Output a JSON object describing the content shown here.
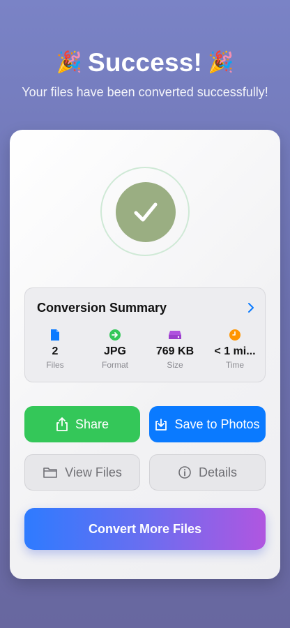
{
  "header": {
    "emoji_left": "🎉",
    "title": "Success!",
    "emoji_right": "🎉",
    "subtitle": "Your files have been converted successfully!"
  },
  "status_icon": "checkmark-circle-icon",
  "summary": {
    "title": "Conversion Summary",
    "chevron_icon": "chevron-right-icon",
    "stats": [
      {
        "icon": "document-icon",
        "icon_color": "#0a7aff",
        "value": "2",
        "label": "Files"
      },
      {
        "icon": "arrow-right-circle-icon",
        "icon_color": "#34c759",
        "value": "JPG",
        "label": "Format"
      },
      {
        "icon": "storage-drive-icon",
        "icon_color": "#af52de",
        "value": "769 KB",
        "label": "Size"
      },
      {
        "icon": "clock-icon",
        "icon_color": "#ff9500",
        "value": "< 1 mi...",
        "label": "Time"
      }
    ]
  },
  "actions": {
    "share_label": "Share",
    "save_label": "Save to Photos",
    "view_label": "View Files",
    "details_label": "Details",
    "convert_label": "Convert More Files"
  },
  "colors": {
    "success_green": "#34c759",
    "primary_blue": "#0a7aff",
    "check_circle": "#9aae82",
    "gradient_start": "#2e7bff",
    "gradient_end": "#b056e0"
  }
}
